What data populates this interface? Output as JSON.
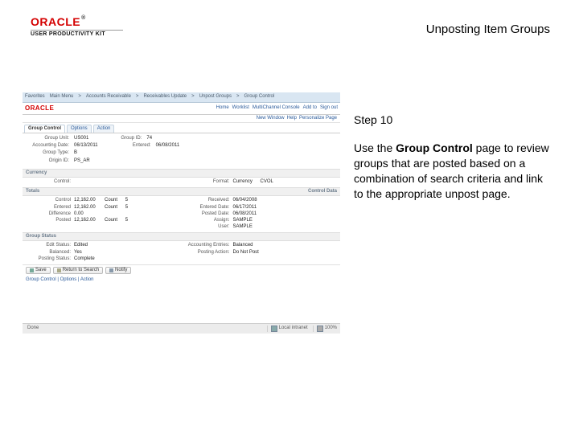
{
  "brand": {
    "logo": "ORACLE",
    "reg": "®",
    "sub": "USER PRODUCTIVITY KIT"
  },
  "topic_title": "Unposting Item Groups",
  "step_label": "Step 10",
  "instruction": {
    "pre": "Use the ",
    "bold": "Group Control",
    "post": " page to review groups that are posted based on a combination of search criteria and link to the appropriate unpost page."
  },
  "mock": {
    "nav": [
      "Favorites",
      "Main Menu",
      ">",
      "Accounts Receivable",
      ">",
      "Receivables Update",
      ">",
      "Unpost Groups",
      ">",
      "Group Control"
    ],
    "brand_small": "ORACLE",
    "topnav": [
      "Home",
      "Worklist",
      "MultiChannel Console",
      "Add to",
      "Sign out"
    ],
    "subnav": [
      "New Window",
      "Help",
      "Personalize Page"
    ],
    "tabs": [
      "Group Control",
      "Options",
      "Action"
    ],
    "active_tab": 0,
    "form": {
      "group_unit_label": "Group Unit:",
      "group_unit": "US001",
      "group_id_label": "Group ID:",
      "group_id": "74",
      "accounting_date_label": "Accounting Date:",
      "accounting_date": "06/13/2011",
      "entered_label": "Entered:",
      "entered": "06/08/2011",
      "group_type_label": "Group Type:",
      "group_type": "B",
      "origin_id_label": "Origin ID:",
      "origin_id": "PS_AR"
    },
    "currency_header": "Currency",
    "currency": {
      "control_label": "Control:",
      "format_label": "Format:",
      "currency": "Currency",
      "currency_control": "CVOL"
    },
    "totals_header": "Totals",
    "control_data_header": "Control Data",
    "totals": {
      "control_label": "Control",
      "entered_label": "Entered",
      "posted_label": "Posted",
      "difference_label": "Difference",
      "control_amount": "12,162.00",
      "entered_amount": "12,162.00",
      "difference_amount": "0.00",
      "posted_amount": "12,162.00",
      "count_label": "Count",
      "count": "5"
    },
    "control_data": {
      "received_label": "Received:",
      "received": "06/04/2008",
      "entered_date_label": "Entered Date:",
      "entered_date": "06/17/2011",
      "posted_date_label": "Posted Date:",
      "posted_date": "06/08/2011",
      "assign_label": "Assign:",
      "assign": "SAMPLE",
      "user_label": "User:",
      "user": "SAMPLE"
    },
    "group_status_header": "Group Status",
    "group_status": {
      "edit_status_label": "Edit Status:",
      "edit_status": "Edited",
      "balanced_label": "Balanced:",
      "balanced": "Yes",
      "posting_status_label": "Posting Status:",
      "posting_status": "Complete",
      "accounting_entries_label": "Accounting Entries:",
      "accounting_entries": "Balanced",
      "posting_action_label": "Posting Action:",
      "posting_action": "Do Not Post"
    },
    "buttons": {
      "save": "Save",
      "return": "Return to Search",
      "notify": "Notify"
    },
    "footer": "Group Control | Options | Action",
    "status": {
      "local": "Local intranet",
      "zoom": "100%"
    }
  }
}
